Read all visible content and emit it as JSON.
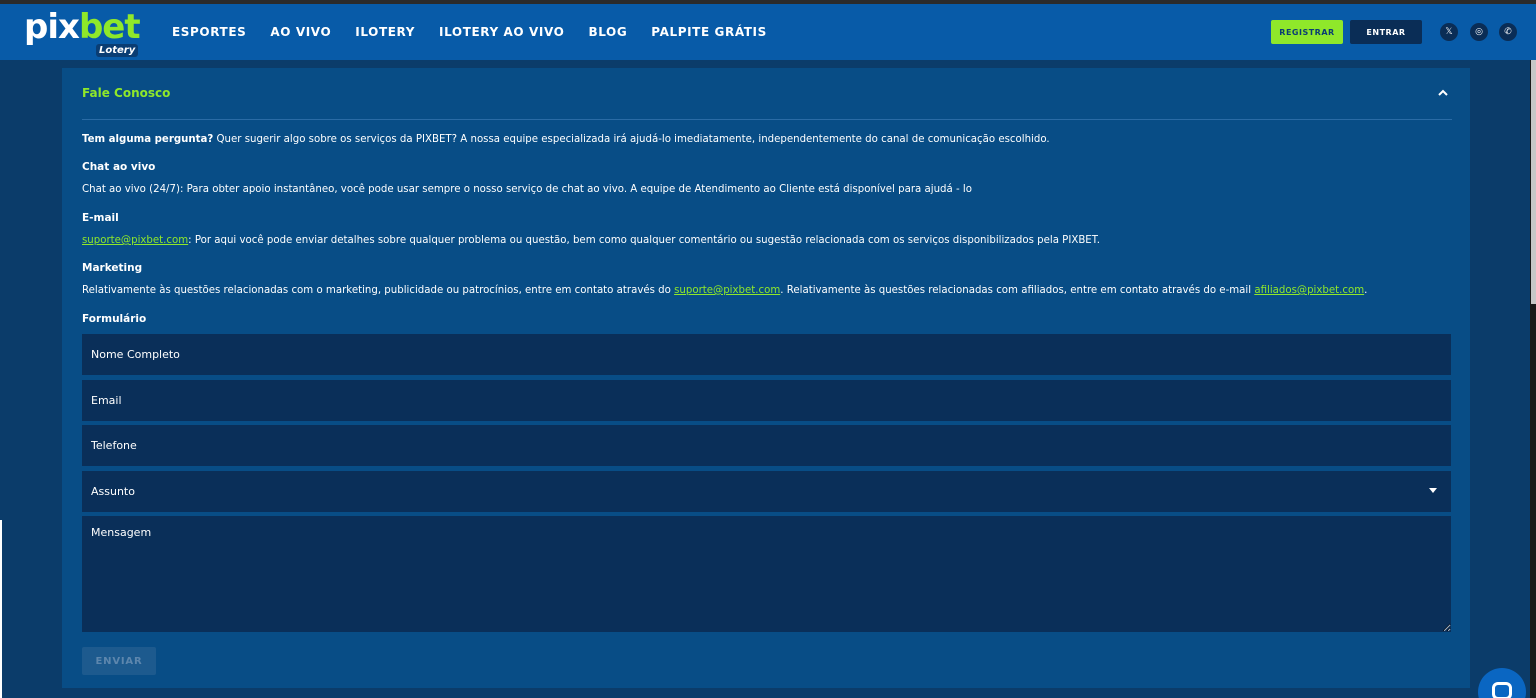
{
  "header": {
    "logo_main_a": "pix",
    "logo_main_b": "bet",
    "logo_sub": "Lotery",
    "nav": [
      "ESPORTES",
      "AO VIVO",
      "ILOTERY",
      "ILOTERY AO VIVO",
      "BLOG",
      "PALPITE GRÁTIS"
    ],
    "register_label": "REGISTRAR",
    "login_label": "ENTRAR",
    "social": [
      {
        "icon": "x-icon",
        "glyph": "𝕏"
      },
      {
        "icon": "instagram-icon",
        "glyph": "◎"
      },
      {
        "icon": "whatsapp-icon",
        "glyph": "✆"
      }
    ]
  },
  "contact": {
    "title": "Fale Conosco",
    "intro_bold": "Tem alguma pergunta?",
    "intro_rest": " Quer sugerir algo sobre os serviços da PIXBET? A nossa equipe especializada irá ajudá-lo imediatamente, independentemente do canal de comunicação escolhido.",
    "chat_heading": "Chat ao vivo",
    "chat_text": "Chat ao vivo (24/7): Para obter apoio instantâneo, você pode usar sempre o nosso serviço de chat ao vivo. A equipe de Atendimento ao Cliente está disponível para ajudá - lo",
    "email_heading": "E-mail",
    "email_link": "suporte@pixbet.com",
    "email_text": ": Por aqui você pode enviar detalhes sobre qualquer problema ou questão, bem como qualquer comentário ou sugestão relacionada com os serviços disponibilizados pela PIXBET.",
    "marketing_heading": "Marketing",
    "marketing_text_a": "Relativamente às questões relacionadas com o marketing, publicidade ou patrocínios, entre em contato através do ",
    "marketing_link_a": "suporte@pixbet.com",
    "marketing_text_b": ". Relativamente às questões relacionadas com afiliados, entre em contato através do e-mail ",
    "marketing_link_b": "afiliados@pixbet.com",
    "marketing_text_c": ".",
    "form_heading": "Formulário"
  },
  "form": {
    "name_placeholder": "Nome Completo",
    "email_placeholder": "Email",
    "phone_placeholder": "Telefone",
    "subject_value": "Assunto",
    "message_placeholder": "Mensagem",
    "submit_label": "ENVIAR"
  },
  "colors": {
    "header_bg": "#085ba8",
    "accent": "#8fe82a",
    "card_bg": "#084d86",
    "field_bg": "#0a2f59"
  }
}
